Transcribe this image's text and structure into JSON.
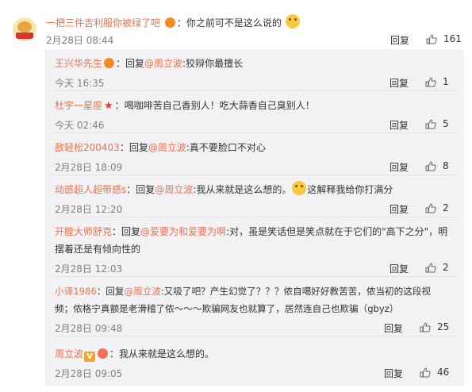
{
  "main_comment": {
    "user": "一把三件吉利服你被绿了吧",
    "sep": "：",
    "text": "你之前可不是这么说的",
    "time": "2月28日 08:44",
    "reply_label": "回复",
    "likes": "161"
  },
  "replies": [
    {
      "user": "王兴华先生",
      "prefix": "：回复",
      "mention": "@周立波",
      "text": ":狡辩你最擅长",
      "time": "今天 16:35",
      "reply_label": "回复",
      "likes": "1"
    },
    {
      "user": "杜宇一星座",
      "prefix": "：",
      "mention": "",
      "text": "喝咖啡苦自己香别人！吃大蒜香自己臭别人！",
      "time": "今天 02:46",
      "reply_label": "回复",
      "likes": "5"
    },
    {
      "user": "敌轻松200403",
      "prefix": "：回复",
      "mention": "@周立波",
      "text": ":真不要脸口不对心",
      "time": "2月28日 18:09",
      "reply_label": "回复",
      "likes": "8"
    },
    {
      "user": "动感超人超带感s",
      "prefix": "：回复",
      "mention": "@周立波",
      "text": ":我从来就是这么想的。",
      "text_after": "这解释我给你打满分",
      "time": "2月28日 12:20",
      "reply_label": "回复",
      "likes": "2"
    },
    {
      "user": "开膛大师舒克",
      "prefix": "：回复",
      "mention": "@爱要为和爱要为啊",
      "text": ":对，虽是笑话但是笑点就在于它们的\"高下之分\"，明",
      "text_line2": "摆着还是有倾向性的",
      "time": "2月28日 12:03",
      "reply_label": "回复",
      "likes": "2"
    },
    {
      "user": "小译1986",
      "prefix": "：回复",
      "mention": "@周立波",
      "text": ":又吸了吧？产生幻觉了？？？侬自噶好好教苦苦，侬当初的这段视",
      "text_line2": "频；侬格宁真额是老滑稽了侬～～～欺骗网友也就算了，居然连自己也欺骗（gbyz）",
      "time": "2月28日 09:48",
      "reply_label": "回复",
      "likes": "25"
    },
    {
      "user": "周立波",
      "prefix": "：",
      "mention": "",
      "text": "我从来就是这么想的。",
      "time": "2月28日 09:05",
      "reply_label": "回复",
      "likes": "46"
    }
  ],
  "colors": {
    "username": "#eb7350",
    "panel_bg": "#f2f2f5",
    "meta": "#808080"
  }
}
